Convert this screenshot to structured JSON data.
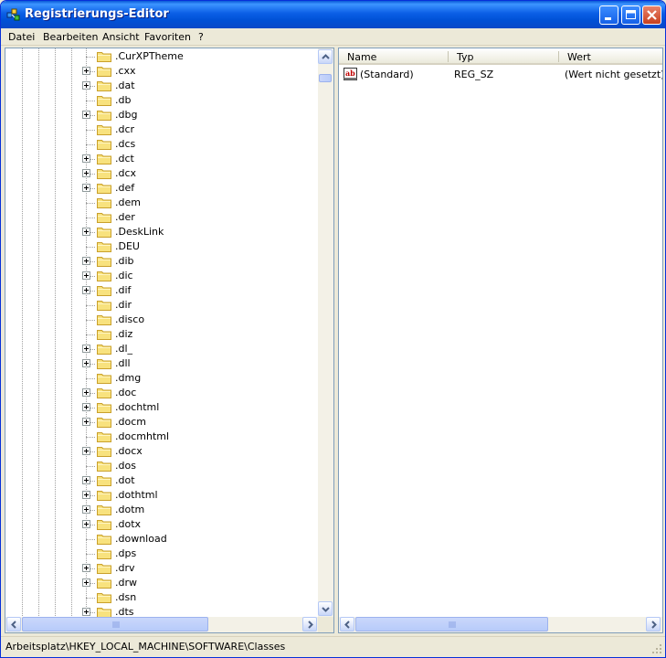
{
  "window": {
    "title": "Registrierungs-Editor",
    "title_icon": "regedit-icon",
    "controls": [
      "minimize",
      "maximize",
      "close"
    ]
  },
  "menu": [
    {
      "label": "Datei"
    },
    {
      "label": "Bearbeiten"
    },
    {
      "label": "Ansicht"
    },
    {
      "label": "Favoriten"
    },
    {
      "label": "?"
    }
  ],
  "tree": {
    "nodes": [
      {
        "label": ".CurXPTheme",
        "expandable": false
      },
      {
        "label": ".cxx",
        "expandable": true
      },
      {
        "label": ".dat",
        "expandable": true
      },
      {
        "label": ".db",
        "expandable": false
      },
      {
        "label": ".dbg",
        "expandable": true
      },
      {
        "label": ".dcr",
        "expandable": false
      },
      {
        "label": ".dcs",
        "expandable": false
      },
      {
        "label": ".dct",
        "expandable": true
      },
      {
        "label": ".dcx",
        "expandable": true
      },
      {
        "label": ".def",
        "expandable": true
      },
      {
        "label": ".dem",
        "expandable": false
      },
      {
        "label": ".der",
        "expandable": false
      },
      {
        "label": ".DeskLink",
        "expandable": true
      },
      {
        "label": ".DEU",
        "expandable": false
      },
      {
        "label": ".dib",
        "expandable": true
      },
      {
        "label": ".dic",
        "expandable": true
      },
      {
        "label": ".dif",
        "expandable": true
      },
      {
        "label": ".dir",
        "expandable": false
      },
      {
        "label": ".disco",
        "expandable": false
      },
      {
        "label": ".diz",
        "expandable": false
      },
      {
        "label": ".dl_",
        "expandable": true
      },
      {
        "label": ".dll",
        "expandable": true
      },
      {
        "label": ".dmg",
        "expandable": false
      },
      {
        "label": ".doc",
        "expandable": true
      },
      {
        "label": ".dochtml",
        "expandable": true
      },
      {
        "label": ".docm",
        "expandable": true
      },
      {
        "label": ".docmhtml",
        "expandable": false
      },
      {
        "label": ".docx",
        "expandable": true
      },
      {
        "label": ".dos",
        "expandable": false
      },
      {
        "label": ".dot",
        "expandable": true
      },
      {
        "label": ".dothtml",
        "expandable": true
      },
      {
        "label": ".dotm",
        "expandable": true
      },
      {
        "label": ".dotx",
        "expandable": true
      },
      {
        "label": ".download",
        "expandable": false
      },
      {
        "label": ".dps",
        "expandable": false
      },
      {
        "label": ".drv",
        "expandable": true
      },
      {
        "label": ".drw",
        "expandable": true
      },
      {
        "label": ".dsn",
        "expandable": false
      },
      {
        "label": ".dts",
        "expandable": true
      }
    ]
  },
  "list": {
    "columns": [
      {
        "label": "Name"
      },
      {
        "label": "Typ"
      },
      {
        "label": "Wert"
      }
    ],
    "rows": [
      {
        "icon": "string-value-icon",
        "icon_text": "ab",
        "name": "(Standard)",
        "type": "REG_SZ",
        "value": "(Wert nicht gesetzt)"
      }
    ]
  },
  "status": {
    "path": "Arbeitsplatz\\HKEY_LOCAL_MACHINE\\SOFTWARE\\Classes"
  },
  "colors": {
    "titlebar": "#0a5ad8",
    "window_bg": "#ece9d8",
    "folder_fill": "#f8e27e",
    "folder_stroke": "#c9a02b",
    "pane_border": "#7f9db9",
    "close_button": "#d9502a"
  }
}
